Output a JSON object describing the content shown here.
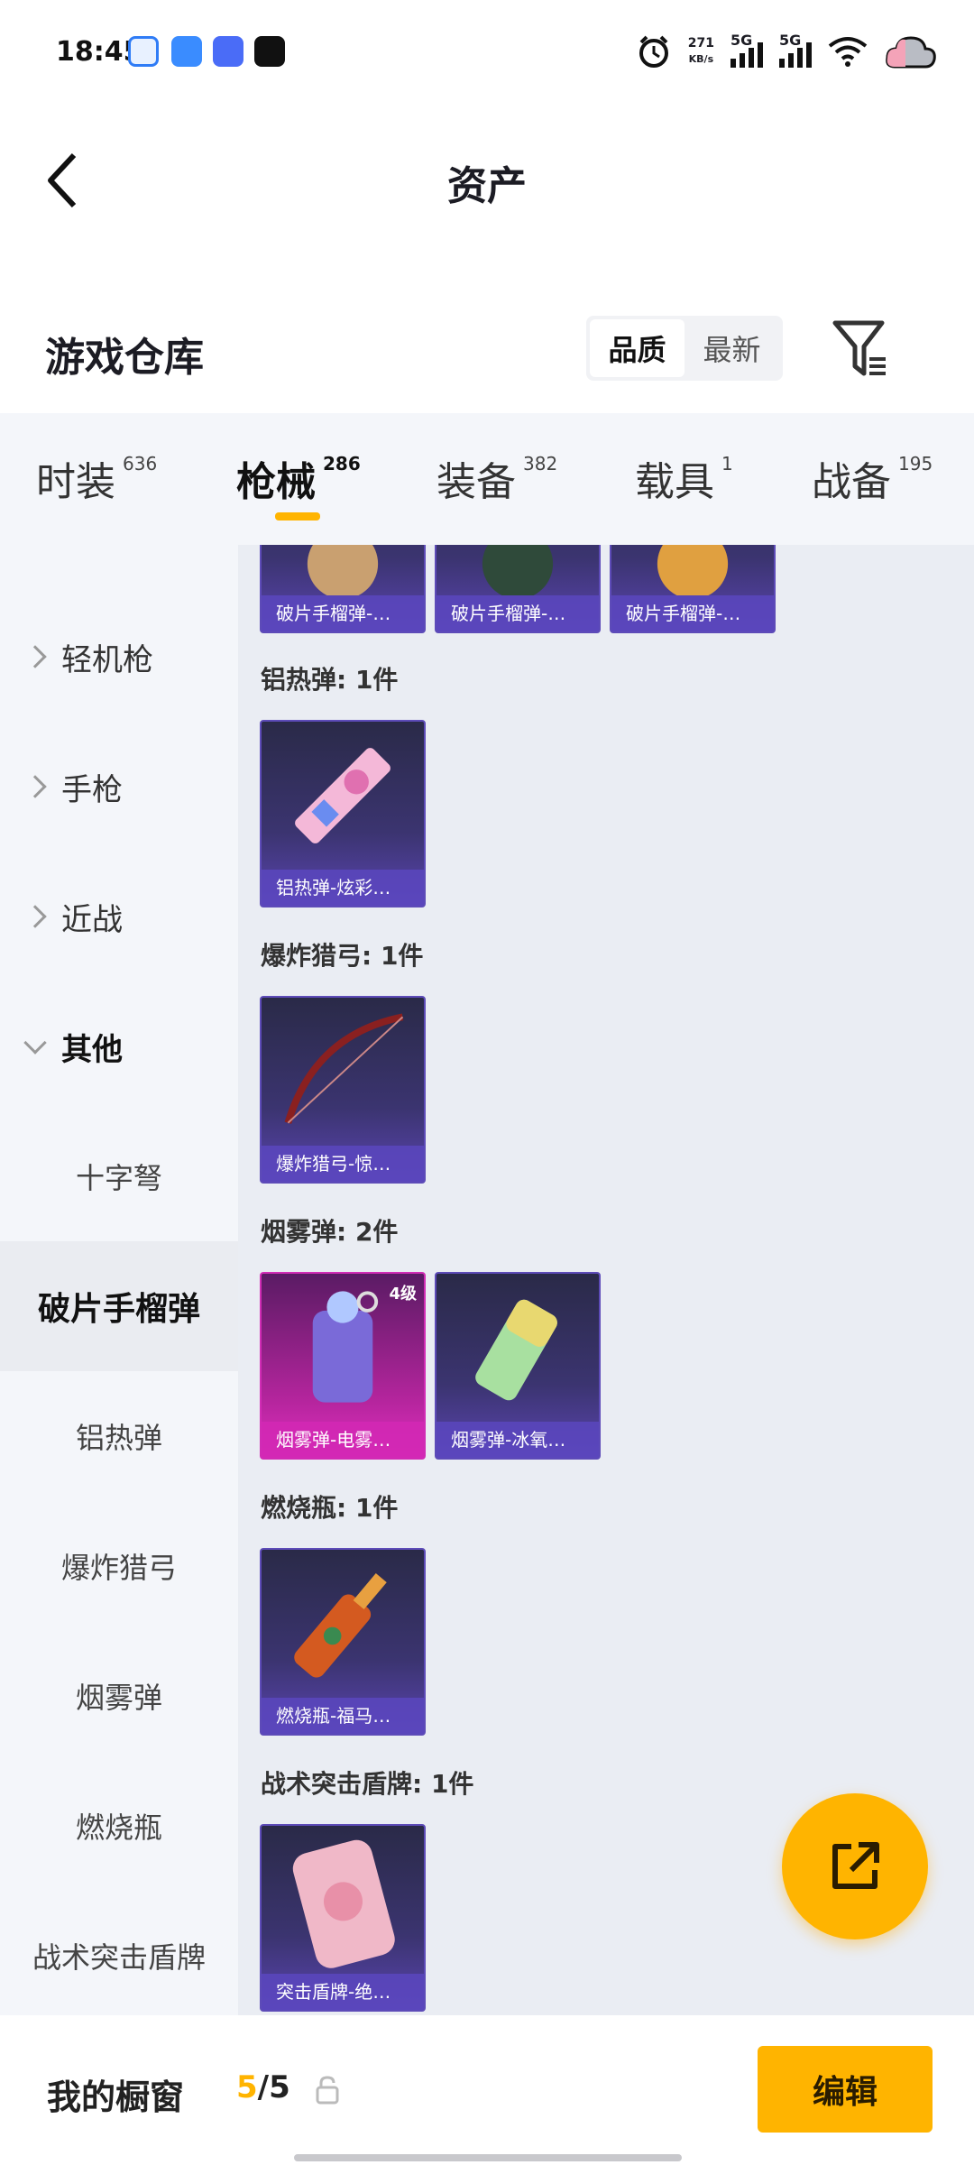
{
  "status_bar": {
    "time": "18:45",
    "speed_value": "271",
    "speed_unit": "KB/s",
    "sig1": "5G",
    "sig2": "5G"
  },
  "header": {
    "title": "资产"
  },
  "warehouse": {
    "title": "游戏仓库",
    "sort_options": [
      "品质",
      "最新"
    ],
    "sort_selected": "品质"
  },
  "tabs": [
    {
      "label": "时装",
      "count": "636"
    },
    {
      "label": "枪械",
      "count": "286",
      "active": true
    },
    {
      "label": "装备",
      "count": "382"
    },
    {
      "label": "载具",
      "count": "1"
    },
    {
      "label": "战备",
      "count": "195"
    }
  ],
  "sidebar": {
    "items": [
      {
        "label": "轻机枪"
      },
      {
        "label": "手枪"
      },
      {
        "label": "近战"
      },
      {
        "label": "其他"
      },
      {
        "label": "十字弩"
      },
      {
        "label": "破片手榴弹"
      },
      {
        "label": "铝热弹"
      },
      {
        "label": "爆炸猎弓"
      },
      {
        "label": "烟雾弹"
      },
      {
        "label": "燃烧瓶"
      },
      {
        "label": "战术突击盾牌"
      }
    ]
  },
  "content": {
    "top_row": [
      "破片手榴弹-…",
      "破片手榴弹-…",
      "破片手榴弹-…"
    ],
    "groups": [
      {
        "label": "铝热弹: 1件",
        "items": [
          "铝热弹-炫彩…"
        ]
      },
      {
        "label": "爆炸猎弓: 1件",
        "items": [
          "爆炸猎弓-惊…"
        ]
      },
      {
        "label": "烟雾弹: 2件",
        "items": [
          "烟雾弹-电雾…",
          "烟雾弹-冰氧…"
        ],
        "level": "4级"
      },
      {
        "label": "燃烧瓶: 1件",
        "items": [
          "燃烧瓶-福马…"
        ]
      },
      {
        "label": "战术突击盾牌: 1件",
        "items": [
          "突击盾牌-绝…"
        ]
      }
    ]
  },
  "bottom": {
    "showcase_label": "我的橱窗",
    "count_current": "5",
    "count_total": "/5",
    "edit_label": "编辑"
  },
  "colors": {
    "accent": "#ffb400",
    "card_purple": "#5d4bb8",
    "card_pink": "#d12cb5"
  }
}
